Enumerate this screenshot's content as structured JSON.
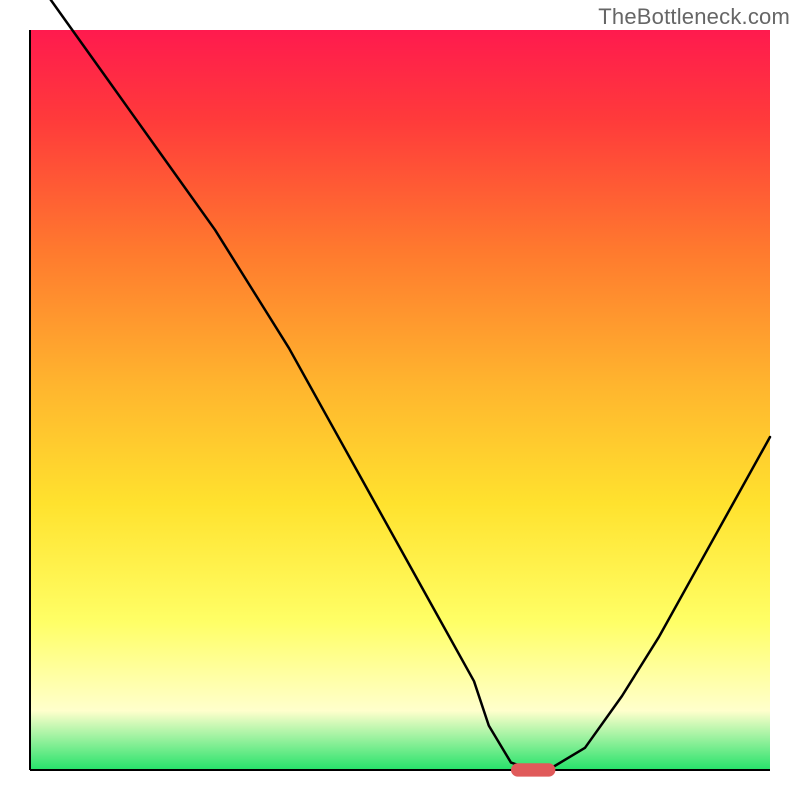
{
  "watermark": "TheBottleneck.com",
  "colors": {
    "gradient_top": "#ff1a4e",
    "gradient_red": "#ff3a3b",
    "gradient_orange": "#ff7a2e",
    "gradient_yellow_orange": "#ffb52e",
    "gradient_yellow": "#ffe22e",
    "gradient_light_yellow": "#ffff66",
    "gradient_pale": "#ffffcc",
    "gradient_green": "#25e26a",
    "axis": "#000000",
    "line": "#000000",
    "marker_fill": "#e05a5a",
    "marker_stroke": "#d94d4d"
  },
  "chart_data": {
    "type": "line",
    "title": "",
    "xlabel": "",
    "ylabel": "",
    "xlim": [
      0,
      100
    ],
    "ylim": [
      0,
      100
    ],
    "x": [
      0,
      5,
      10,
      15,
      20,
      25,
      30,
      35,
      40,
      45,
      50,
      55,
      60,
      62,
      65,
      68,
      70,
      75,
      80,
      85,
      90,
      95,
      100
    ],
    "values": [
      108,
      101,
      94,
      87,
      80,
      73,
      65,
      57,
      48,
      39,
      30,
      21,
      12,
      6,
      1,
      0,
      0,
      3,
      10,
      18,
      27,
      36,
      45
    ],
    "marker": {
      "x_center": 68,
      "y": 0,
      "width": 6,
      "height": 1.8
    },
    "grid": false,
    "legend": null
  }
}
